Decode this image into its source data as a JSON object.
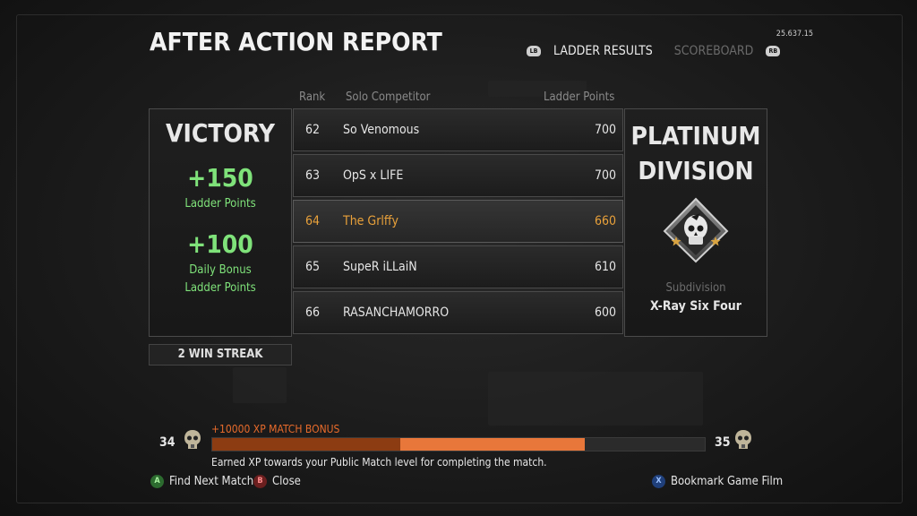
{
  "version": "25.637.15",
  "title": "AFTER ACTION REPORT",
  "tabs": {
    "left_button": "LB",
    "right_button": "RB",
    "active": "LADDER RESULTS",
    "inactive": "SCOREBOARD"
  },
  "columns": {
    "rank": "Rank",
    "competitor": "Solo Competitor",
    "points": "Ladder Points"
  },
  "result": {
    "outcome": "VICTORY",
    "ladder_gain": "+150",
    "ladder_gain_label": "Ladder Points",
    "bonus_gain": "+100",
    "bonus_label_1": "Daily Bonus",
    "bonus_label_2": "Ladder Points",
    "streak": "2 WIN STREAK"
  },
  "ladder": [
    {
      "rank": "62",
      "name": "So Venomous",
      "points": "700",
      "highlight": false
    },
    {
      "rank": "63",
      "name": "OpS x LIFE",
      "points": "700",
      "highlight": false
    },
    {
      "rank": "64",
      "name": "The Grlffy",
      "points": "660",
      "highlight": true
    },
    {
      "rank": "65",
      "name": "SupeR iLLaiN",
      "points": "610",
      "highlight": false
    },
    {
      "rank": "66",
      "name": "RASANCHAMORRO",
      "points": "600",
      "highlight": false
    }
  ],
  "division": {
    "line1": "PLATINUM",
    "line2": "DIVISION",
    "emblem_icon": "skull-emblem-icon",
    "subdivision_label": "Subdivision",
    "subdivision_name": "X-Ray Six Four"
  },
  "xp": {
    "current_level": "34",
    "next_level": "35",
    "bonus_text": "+10000 XP MATCH BONUS",
    "base_progress": 0.381,
    "total_progress": 0.757,
    "earned_text": "Earned XP towards your Public Match level for completing the match.",
    "base_color": "#8c3c12",
    "gain_color": "#e8773a"
  },
  "footer": {
    "find_btn": "A",
    "find_label": "Find Next Match",
    "close_btn": "B",
    "close_label": "Close",
    "bookmark_btn": "X",
    "bookmark_label": "Bookmark Game Film"
  },
  "colors": {
    "victory_green": "#7fe27a",
    "highlight_orange": "#e9a13a"
  }
}
